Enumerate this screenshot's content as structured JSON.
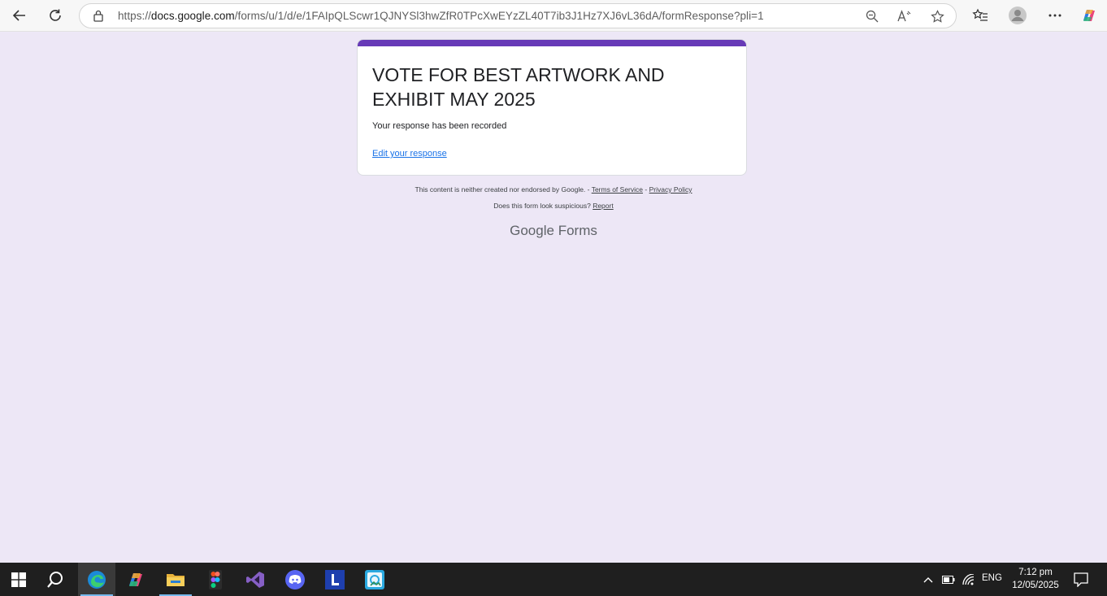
{
  "browser": {
    "url_prefix": "https://",
    "url_host": "docs.google.com",
    "url_path": "/forms/u/1/d/e/1FAIpQLScwr1QJNYSl3hwZfR0TPcXwEYzZL40T7ib3J1Hz7XJ6vL36dA/formResponse?pli=1"
  },
  "form": {
    "title": "VOTE FOR BEST ARTWORK AND EXHIBIT MAY 2025",
    "confirmation": "Your response has been recorded",
    "edit_link": "Edit your response",
    "accent_color": "#673ab7",
    "background_color": "#ede7f6"
  },
  "footer": {
    "disclaimer": "This content is neither created nor endorsed by Google. -",
    "terms": "Terms of Service",
    "separator": "-",
    "privacy": "Privacy Policy",
    "suspicious": "Does this form look suspicious?",
    "report": "Report",
    "brand_google": "Google",
    "brand_forms": "Forms"
  },
  "taskbar": {
    "apps": [
      "start-icon",
      "search-icon",
      "edge-icon",
      "copilot-icon",
      "file-explorer-icon",
      "figma-icon",
      "visual-studio-icon",
      "discord-icon",
      "l-app-icon",
      "photos-app-icon"
    ],
    "language": "ENG",
    "time": "7:12 pm",
    "date": "12/05/2025"
  }
}
